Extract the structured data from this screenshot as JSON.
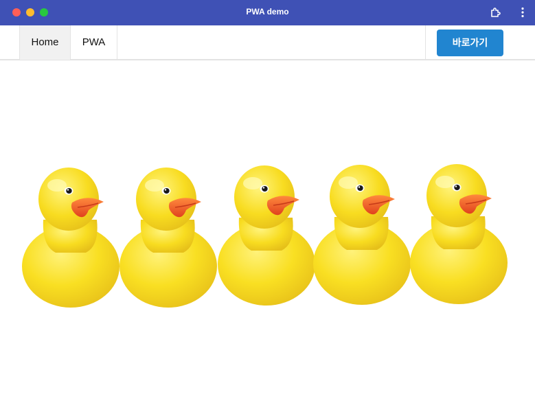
{
  "window": {
    "title": "PWA demo"
  },
  "titlebar_icons": [
    "extension-icon",
    "more-vert-icon"
  ],
  "nav": {
    "items": [
      {
        "label": "Home",
        "active": true
      },
      {
        "label": "PWA",
        "active": false
      }
    ],
    "cta_label": "바로가기"
  },
  "hero_image": {
    "subject": "five yellow rubber ducks",
    "count": 5
  },
  "colors": {
    "titlebar": "#3f51b5",
    "button": "#2185d0",
    "duck_body": "#f7dc1f",
    "duck_beak": "#f05a28"
  }
}
